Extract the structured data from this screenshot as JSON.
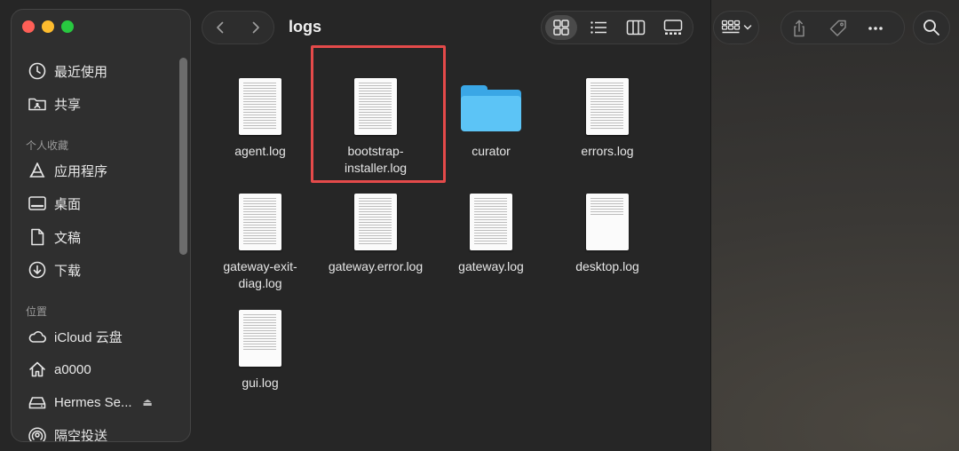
{
  "window": {
    "title": "logs",
    "sidebar": {
      "favorites_top": [
        {
          "label": "最近使用",
          "icon": "clock-icon"
        },
        {
          "label": "共享",
          "icon": "shared-folder-icon"
        }
      ],
      "section_favorites": "个人收藏",
      "favorites": [
        {
          "label": "应用程序",
          "icon": "applications-icon"
        },
        {
          "label": "桌面",
          "icon": "desktop-icon"
        },
        {
          "label": "文稿",
          "icon": "document-icon"
        },
        {
          "label": "下载",
          "icon": "download-icon"
        }
      ],
      "section_locations": "位置",
      "locations": [
        {
          "label": "iCloud 云盘",
          "icon": "cloud-icon"
        },
        {
          "label": "a0000",
          "icon": "home-icon"
        },
        {
          "label": "Hermes Se...",
          "icon": "drive-icon",
          "eject": "⏏"
        },
        {
          "label": "隔空投送",
          "icon": "airdrop-icon"
        }
      ]
    },
    "files": [
      {
        "name": "agent.log",
        "kind": "document"
      },
      {
        "name": "bootstrap-installer.log",
        "line1": "bootstrap-",
        "line2": "installer.log",
        "kind": "document",
        "highlighted": true
      },
      {
        "name": "curator",
        "kind": "folder"
      },
      {
        "name": "errors.log",
        "kind": "document"
      },
      {
        "name": "gateway-exit-diag.log",
        "line1": "gateway-exit-",
        "line2": "diag.log",
        "kind": "document"
      },
      {
        "name": "gateway.error.log",
        "kind": "document"
      },
      {
        "name": "gateway.log",
        "kind": "document"
      },
      {
        "name": "desktop.log",
        "kind": "document"
      },
      {
        "name": "gui.log",
        "kind": "document"
      }
    ],
    "colors": {
      "accent_folder": "#5cc4f6",
      "highlight": "#e44a4a",
      "traffic_close": "#fe5f57",
      "traffic_minimize": "#febc2e",
      "traffic_zoom": "#28c840"
    }
  }
}
